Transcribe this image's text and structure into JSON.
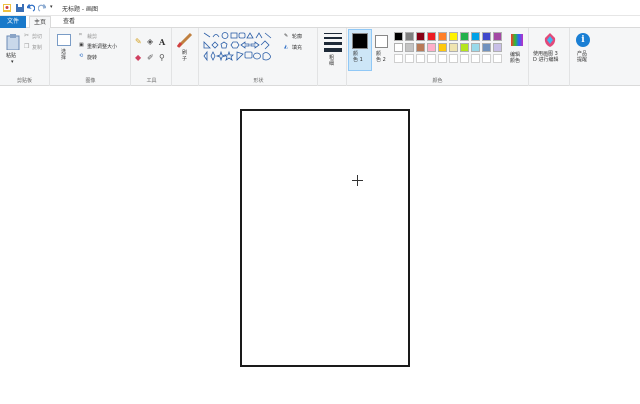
{
  "window": {
    "title": "无标题 - 画图"
  },
  "tabs": {
    "file": "文件",
    "home": "主页",
    "view": "查看"
  },
  "clipboard": {
    "paste": "粘贴",
    "cut": "剪切",
    "copy": "复制",
    "group": "剪贴板"
  },
  "image": {
    "select": "选\n择",
    "crop": "裁剪",
    "resize": "重新调整大小",
    "rotate": "旋转",
    "group": "图像"
  },
  "tools": {
    "group": "工具"
  },
  "brush": {
    "label": "刷\n子"
  },
  "shapes": {
    "outline": "轮廓",
    "fill": "填充",
    "group": "形状"
  },
  "size": {
    "label": "粗\n细"
  },
  "colors": {
    "color1": "颜\n色 1",
    "color2": "颜\n色 2",
    "edit": "编辑\n颜色",
    "group": "颜色",
    "palette_row1": [
      "#000000",
      "#7f7f7f",
      "#880015",
      "#ed1c24",
      "#ff7f27",
      "#fff200",
      "#22b14c",
      "#00a2e8",
      "#3f48cc",
      "#a349a4"
    ],
    "palette_row2": [
      "#ffffff",
      "#c3c3c3",
      "#b97a57",
      "#ffaec9",
      "#ffc90e",
      "#efe4b0",
      "#b5e61d",
      "#99d9ea",
      "#7092be",
      "#c8bfe7"
    ]
  },
  "paint3d": {
    "label": "使用画图 3\nD 进行编辑"
  },
  "product": {
    "label": "产品\n提醒"
  }
}
